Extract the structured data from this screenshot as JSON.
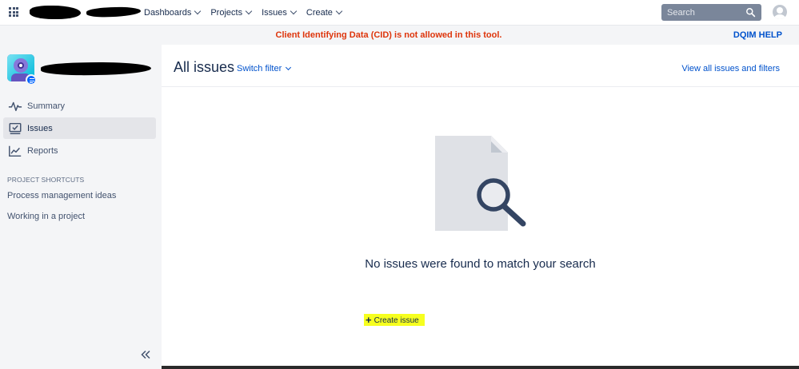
{
  "topnav": {
    "items": [
      {
        "label": "Dashboards"
      },
      {
        "label": "Projects"
      },
      {
        "label": "Issues"
      },
      {
        "label": "Create"
      }
    ],
    "search_placeholder": "Search"
  },
  "banner": {
    "message": "Client Identifying Data (CID) is not allowed in this tool.",
    "help_label": "DQIM HELP",
    "message_color": "#de350b",
    "help_color": "#0052cc"
  },
  "sidebar": {
    "nav": [
      {
        "label": "Summary",
        "icon": "pulse-icon"
      },
      {
        "label": "Issues",
        "icon": "issues-icon"
      },
      {
        "label": "Reports",
        "icon": "reports-icon"
      }
    ],
    "shortcuts_title": "PROJECT SHORTCUTS",
    "shortcuts": [
      {
        "label": "Process management ideas"
      },
      {
        "label": "Working in a project"
      }
    ]
  },
  "main": {
    "title": "All issues",
    "switch_filter_label": "Switch filter",
    "view_all_label": "View all issues and filters",
    "empty_message": "No issues were found to match your search",
    "create_issue_label": "Create issue"
  },
  "colors": {
    "accent": "#0052cc",
    "sidebar_bg": "#f4f5f7",
    "highlight": "#f6ff1f"
  }
}
